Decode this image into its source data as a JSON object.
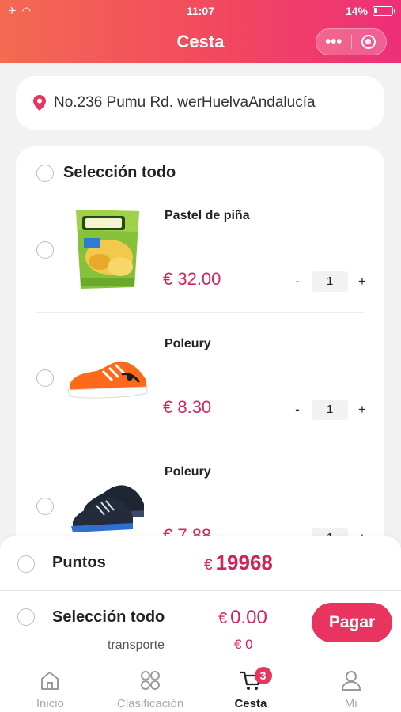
{
  "status_bar": {
    "time": "11:07",
    "battery_percent": "14%"
  },
  "header": {
    "title": "Cesta",
    "more_label": "•••"
  },
  "address": {
    "text": "No.236  Pumu Rd. werHuelvaAndalucía"
  },
  "cart": {
    "select_all_label": "Selección todo",
    "items": [
      {
        "name": "Pastel de piña",
        "price": "€ 32.00",
        "quantity": "1"
      },
      {
        "name": "Poleury",
        "price": "€ 8.30",
        "quantity": "1"
      },
      {
        "name": "Poleury",
        "price": "€ 7.88",
        "quantity": "1"
      }
    ]
  },
  "points": {
    "label": "Puntos",
    "currency": "€",
    "value": "19968"
  },
  "checkout": {
    "select_all_label": "Selección todo",
    "total_currency": "€",
    "total_value": "0.00",
    "shipping_label": "transporte",
    "shipping_value": "€ 0",
    "pay_label": "Pagar"
  },
  "tabbar": {
    "items": [
      {
        "label": "Inicio",
        "icon": "home-icon"
      },
      {
        "label": "Clasificación",
        "icon": "category-icon"
      },
      {
        "label": "Cesta",
        "icon": "cart-icon",
        "badge": "3",
        "active": true
      },
      {
        "label": "Mi",
        "icon": "user-icon"
      }
    ]
  },
  "colors": {
    "accent": "#e8345f",
    "price": "#d0245a",
    "header_start": "#f46a52",
    "header_end": "#ee2f78"
  }
}
